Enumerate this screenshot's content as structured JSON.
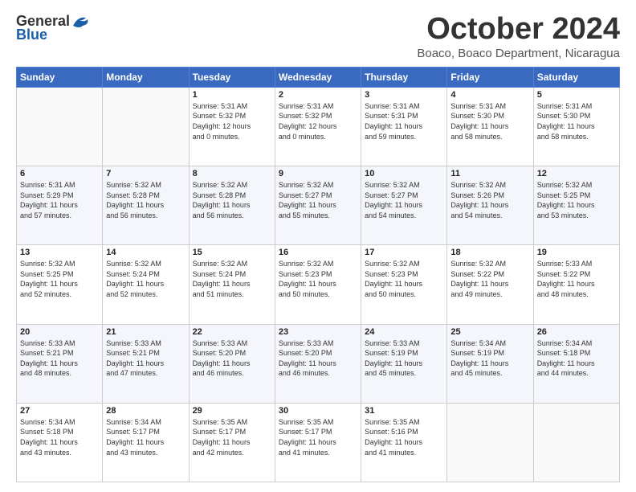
{
  "logo": {
    "general": "General",
    "blue": "Blue"
  },
  "title": "October 2024",
  "location": "Boaco, Boaco Department, Nicaragua",
  "days_header": [
    "Sunday",
    "Monday",
    "Tuesday",
    "Wednesday",
    "Thursday",
    "Friday",
    "Saturday"
  ],
  "weeks": [
    [
      {
        "day": "",
        "info": ""
      },
      {
        "day": "",
        "info": ""
      },
      {
        "day": "1",
        "info": "Sunrise: 5:31 AM\nSunset: 5:32 PM\nDaylight: 12 hours\nand 0 minutes."
      },
      {
        "day": "2",
        "info": "Sunrise: 5:31 AM\nSunset: 5:32 PM\nDaylight: 12 hours\nand 0 minutes."
      },
      {
        "day": "3",
        "info": "Sunrise: 5:31 AM\nSunset: 5:31 PM\nDaylight: 11 hours\nand 59 minutes."
      },
      {
        "day": "4",
        "info": "Sunrise: 5:31 AM\nSunset: 5:30 PM\nDaylight: 11 hours\nand 58 minutes."
      },
      {
        "day": "5",
        "info": "Sunrise: 5:31 AM\nSunset: 5:30 PM\nDaylight: 11 hours\nand 58 minutes."
      }
    ],
    [
      {
        "day": "6",
        "info": "Sunrise: 5:31 AM\nSunset: 5:29 PM\nDaylight: 11 hours\nand 57 minutes."
      },
      {
        "day": "7",
        "info": "Sunrise: 5:32 AM\nSunset: 5:28 PM\nDaylight: 11 hours\nand 56 minutes."
      },
      {
        "day": "8",
        "info": "Sunrise: 5:32 AM\nSunset: 5:28 PM\nDaylight: 11 hours\nand 56 minutes."
      },
      {
        "day": "9",
        "info": "Sunrise: 5:32 AM\nSunset: 5:27 PM\nDaylight: 11 hours\nand 55 minutes."
      },
      {
        "day": "10",
        "info": "Sunrise: 5:32 AM\nSunset: 5:27 PM\nDaylight: 11 hours\nand 54 minutes."
      },
      {
        "day": "11",
        "info": "Sunrise: 5:32 AM\nSunset: 5:26 PM\nDaylight: 11 hours\nand 54 minutes."
      },
      {
        "day": "12",
        "info": "Sunrise: 5:32 AM\nSunset: 5:25 PM\nDaylight: 11 hours\nand 53 minutes."
      }
    ],
    [
      {
        "day": "13",
        "info": "Sunrise: 5:32 AM\nSunset: 5:25 PM\nDaylight: 11 hours\nand 52 minutes."
      },
      {
        "day": "14",
        "info": "Sunrise: 5:32 AM\nSunset: 5:24 PM\nDaylight: 11 hours\nand 52 minutes."
      },
      {
        "day": "15",
        "info": "Sunrise: 5:32 AM\nSunset: 5:24 PM\nDaylight: 11 hours\nand 51 minutes."
      },
      {
        "day": "16",
        "info": "Sunrise: 5:32 AM\nSunset: 5:23 PM\nDaylight: 11 hours\nand 50 minutes."
      },
      {
        "day": "17",
        "info": "Sunrise: 5:32 AM\nSunset: 5:23 PM\nDaylight: 11 hours\nand 50 minutes."
      },
      {
        "day": "18",
        "info": "Sunrise: 5:32 AM\nSunset: 5:22 PM\nDaylight: 11 hours\nand 49 minutes."
      },
      {
        "day": "19",
        "info": "Sunrise: 5:33 AM\nSunset: 5:22 PM\nDaylight: 11 hours\nand 48 minutes."
      }
    ],
    [
      {
        "day": "20",
        "info": "Sunrise: 5:33 AM\nSunset: 5:21 PM\nDaylight: 11 hours\nand 48 minutes."
      },
      {
        "day": "21",
        "info": "Sunrise: 5:33 AM\nSunset: 5:21 PM\nDaylight: 11 hours\nand 47 minutes."
      },
      {
        "day": "22",
        "info": "Sunrise: 5:33 AM\nSunset: 5:20 PM\nDaylight: 11 hours\nand 46 minutes."
      },
      {
        "day": "23",
        "info": "Sunrise: 5:33 AM\nSunset: 5:20 PM\nDaylight: 11 hours\nand 46 minutes."
      },
      {
        "day": "24",
        "info": "Sunrise: 5:33 AM\nSunset: 5:19 PM\nDaylight: 11 hours\nand 45 minutes."
      },
      {
        "day": "25",
        "info": "Sunrise: 5:34 AM\nSunset: 5:19 PM\nDaylight: 11 hours\nand 45 minutes."
      },
      {
        "day": "26",
        "info": "Sunrise: 5:34 AM\nSunset: 5:18 PM\nDaylight: 11 hours\nand 44 minutes."
      }
    ],
    [
      {
        "day": "27",
        "info": "Sunrise: 5:34 AM\nSunset: 5:18 PM\nDaylight: 11 hours\nand 43 minutes."
      },
      {
        "day": "28",
        "info": "Sunrise: 5:34 AM\nSunset: 5:17 PM\nDaylight: 11 hours\nand 43 minutes."
      },
      {
        "day": "29",
        "info": "Sunrise: 5:35 AM\nSunset: 5:17 PM\nDaylight: 11 hours\nand 42 minutes."
      },
      {
        "day": "30",
        "info": "Sunrise: 5:35 AM\nSunset: 5:17 PM\nDaylight: 11 hours\nand 41 minutes."
      },
      {
        "day": "31",
        "info": "Sunrise: 5:35 AM\nSunset: 5:16 PM\nDaylight: 11 hours\nand 41 minutes."
      },
      {
        "day": "",
        "info": ""
      },
      {
        "day": "",
        "info": ""
      }
    ]
  ]
}
